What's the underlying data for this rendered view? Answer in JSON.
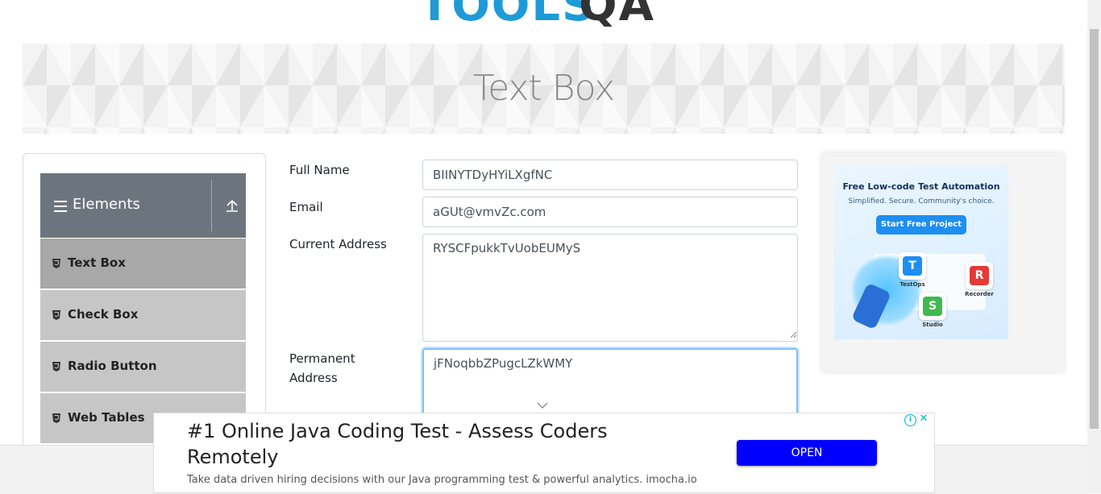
{
  "logo": {
    "part1": "TOOLS",
    "part2": "QA"
  },
  "page": {
    "title": "Text Box"
  },
  "sidebar": {
    "group": "Elements",
    "items": [
      {
        "label": "Text Box"
      },
      {
        "label": "Check Box"
      },
      {
        "label": "Radio Button"
      },
      {
        "label": "Web Tables"
      }
    ]
  },
  "form": {
    "full_name_label": "Full Name",
    "full_name_value": "BIINYTDyHYiLXgfNC",
    "email_label": "Email",
    "email_value": "aGUt@vmvZc.com",
    "current_address_label": "Current Address",
    "current_address_value": "RYSCFpukkTvUobEUMyS",
    "permanent_address_label_1": "Permanent",
    "permanent_address_label_2": "Address",
    "permanent_address_value": "jFNoqbbZPugcLZkWMY"
  },
  "side_ad": {
    "title": "Free Low-code Test Automation",
    "subtitle": "Simplified. Secure. Community's choice.",
    "button": "Start Free Project",
    "cards": [
      {
        "letter": "T",
        "caption": "TestOps",
        "color": "#1d8ef2"
      },
      {
        "letter": "R",
        "caption": "Recorder",
        "color": "#e53935"
      },
      {
        "letter": "S",
        "caption": "Studio",
        "color": "#3fb950"
      }
    ]
  },
  "bottom_ad": {
    "headline": "#1 Online Java Coding Test - Assess Coders Remotely",
    "description": "Take data driven hiring decisions with our Java programming test & powerful analytics. imocha.io",
    "button": "OPEN",
    "adchoices": "i",
    "close": "✕"
  },
  "colors": {
    "sidebar_header": "#6c757d",
    "menu_item": "#c6c6c6",
    "menu_item_active": "#a8a8a8",
    "focus_border": "#80bdff",
    "ad_button": "#0000ff"
  }
}
